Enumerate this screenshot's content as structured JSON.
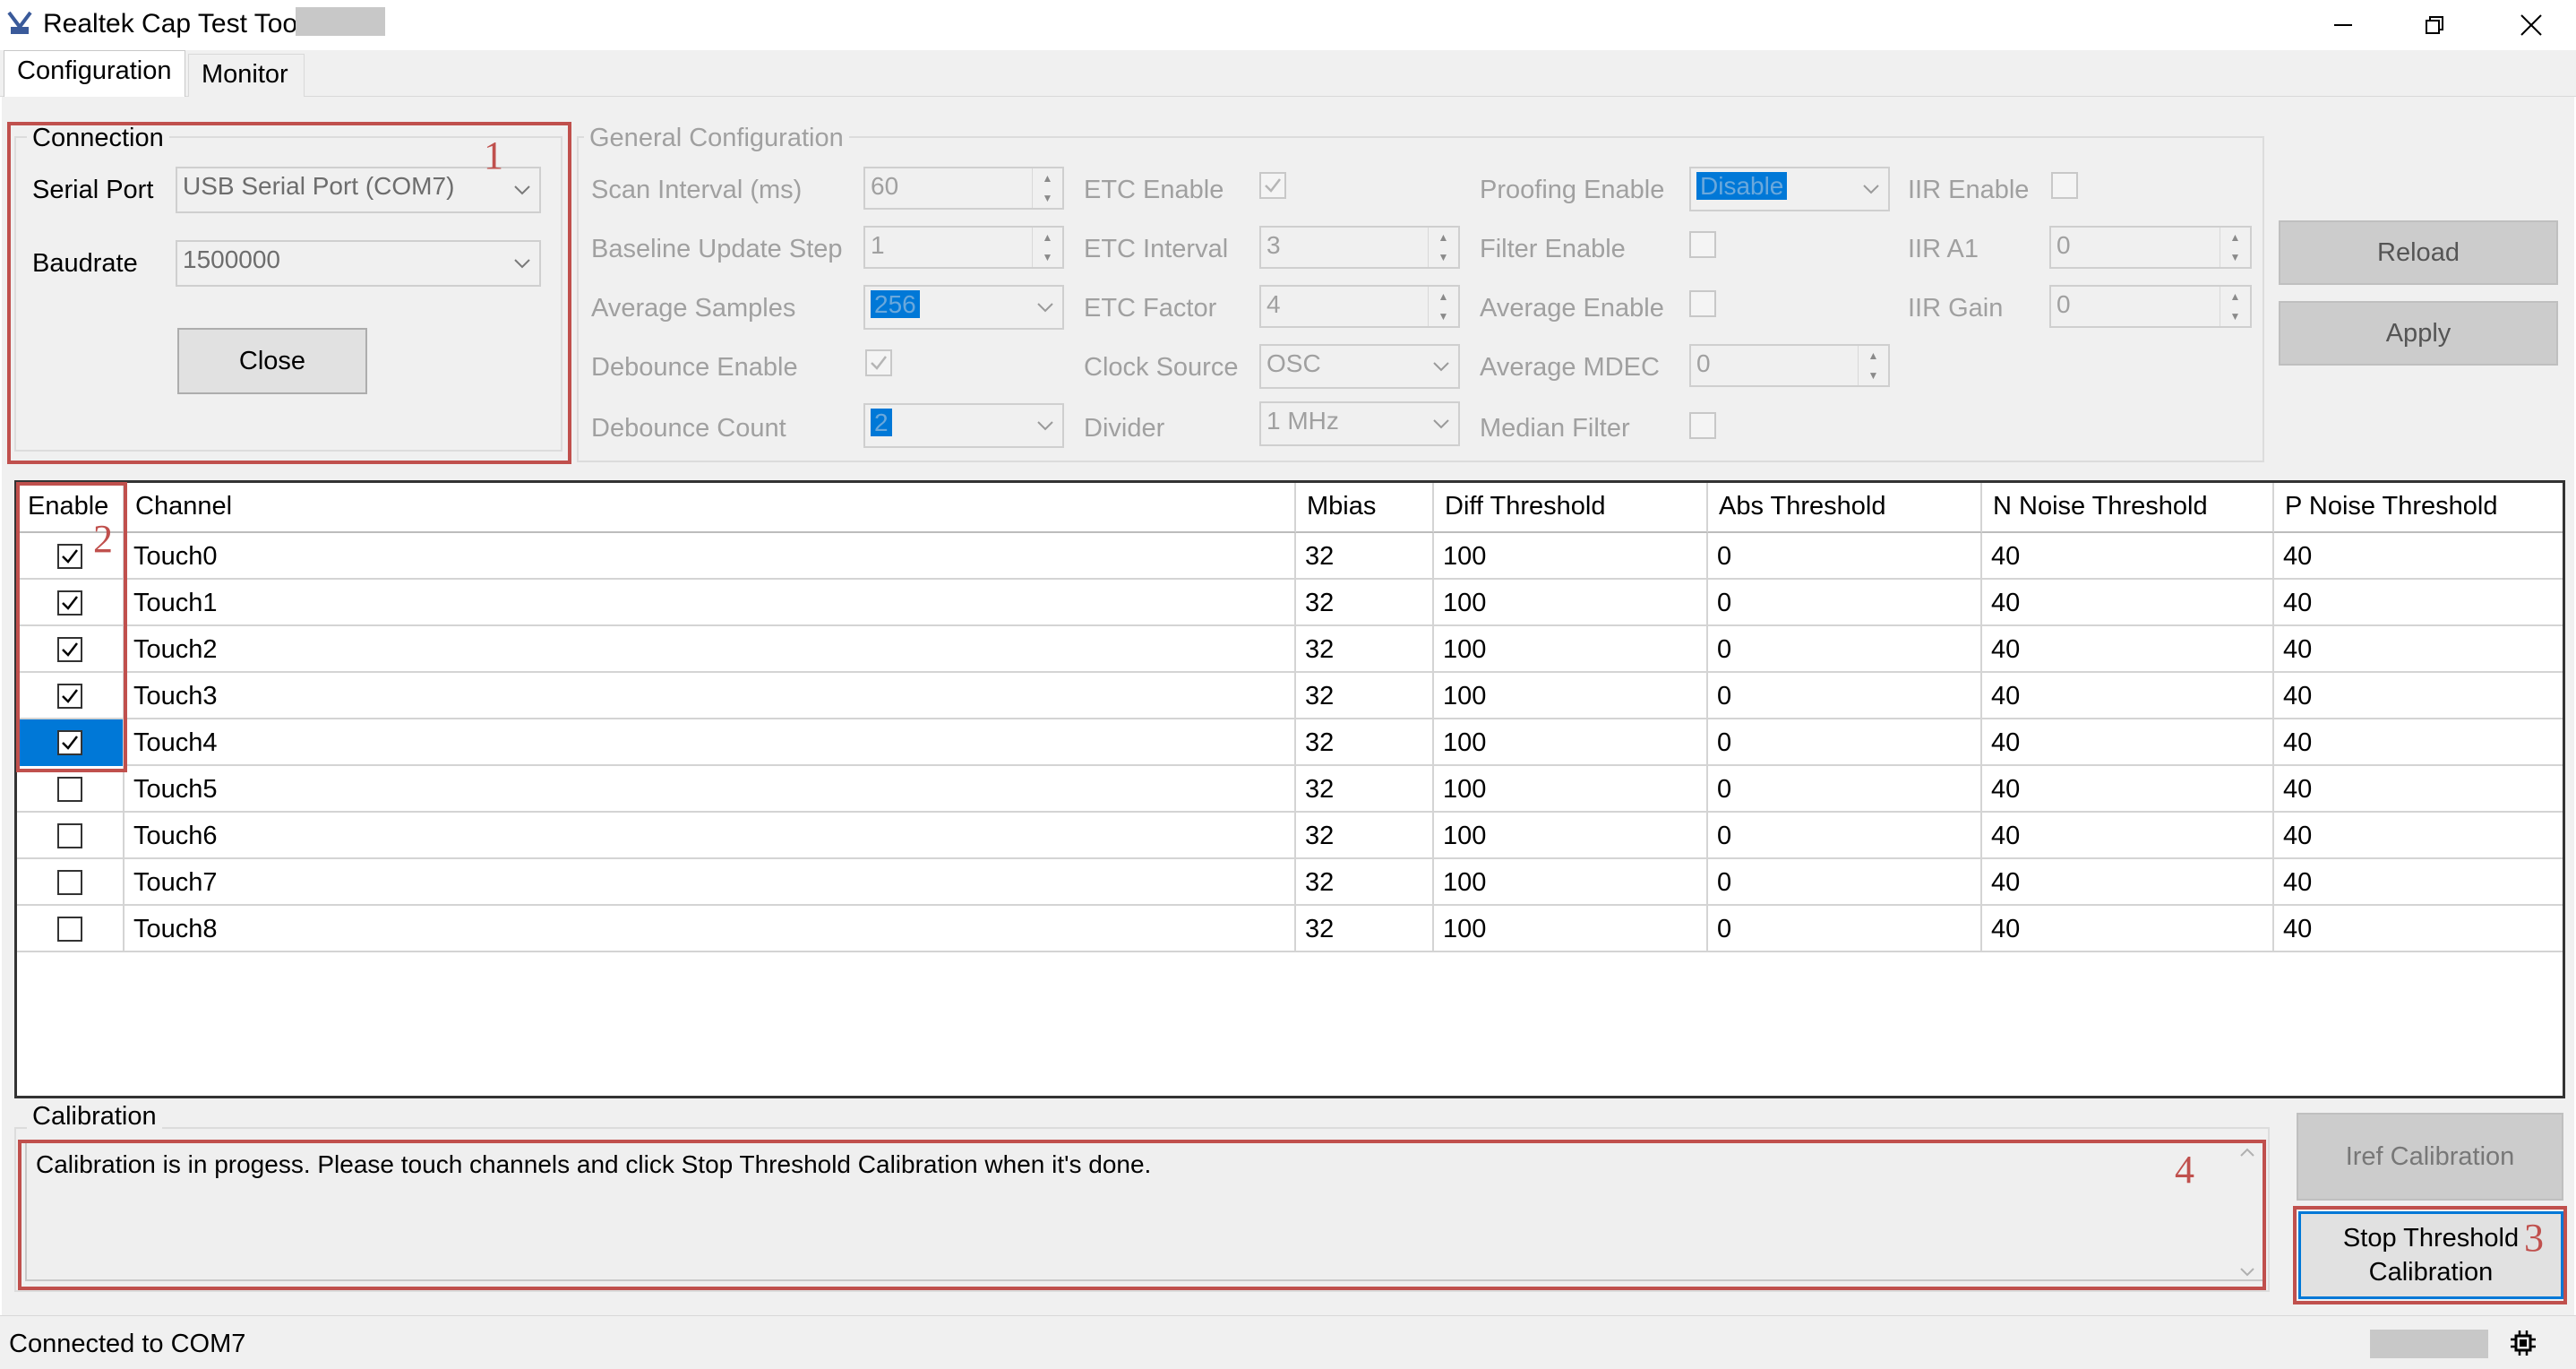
{
  "window": {
    "title": "Realtek Cap Test Tool",
    "controls": {
      "minimize": "minimize",
      "maximize": "restore",
      "close": "close"
    }
  },
  "tabs": [
    {
      "label": "Configuration",
      "selected": true
    },
    {
      "label": "Monitor",
      "selected": false
    }
  ],
  "connection": {
    "title": "Connection",
    "serial_port_label": "Serial Port",
    "serial_port_value": "USB Serial Port (COM7)",
    "baudrate_label": "Baudrate",
    "baudrate_value": "1500000",
    "close_button": "Close"
  },
  "general": {
    "title": "General Configuration",
    "scan_interval_label": "Scan Interval (ms)",
    "scan_interval_value": "60",
    "baseline_update_step_label": "Baseline Update Step",
    "baseline_update_step_value": "1",
    "average_samples_label": "Average Samples",
    "average_samples_value": "256",
    "debounce_enable_label": "Debounce Enable",
    "debounce_enable_checked": true,
    "debounce_count_label": "Debounce Count",
    "debounce_count_value": "2",
    "etc_enable_label": "ETC Enable",
    "etc_enable_checked": true,
    "etc_interval_label": "ETC Interval",
    "etc_interval_value": "3",
    "etc_factor_label": "ETC Factor",
    "etc_factor_value": "4",
    "clock_source_label": "Clock Source",
    "clock_source_value": "OSC",
    "divider_label": "Divider",
    "divider_value": "1 MHz",
    "proofing_enable_label": "Proofing Enable",
    "proofing_enable_value": "Disable",
    "filter_enable_label": "Filter Enable",
    "filter_enable_checked": false,
    "average_enable_label": "Average Enable",
    "average_enable_checked": false,
    "average_mdec_label": "Average MDEC",
    "average_mdec_value": "0",
    "median_filter_label": "Median Filter",
    "median_filter_checked": false,
    "iir_enable_label": "IIR Enable",
    "iir_enable_checked": false,
    "iir_a1_label": "IIR A1",
    "iir_a1_value": "0",
    "iir_gain_label": "IIR Gain",
    "iir_gain_value": "0"
  },
  "actions": {
    "reload": "Reload",
    "apply": "Apply"
  },
  "table": {
    "headers": [
      "Enable",
      "Channel",
      "Mbias",
      "Diff Threshold",
      "Abs Threshold",
      "N Noise Threshold",
      "P Noise Threshold"
    ],
    "rows": [
      {
        "enabled": true,
        "channel": "Touch0",
        "mbias": "32",
        "diff": "100",
        "abs": "0",
        "n_noise": "40",
        "p_noise": "40"
      },
      {
        "enabled": true,
        "channel": "Touch1",
        "mbias": "32",
        "diff": "100",
        "abs": "0",
        "n_noise": "40",
        "p_noise": "40"
      },
      {
        "enabled": true,
        "channel": "Touch2",
        "mbias": "32",
        "diff": "100",
        "abs": "0",
        "n_noise": "40",
        "p_noise": "40"
      },
      {
        "enabled": true,
        "channel": "Touch3",
        "mbias": "32",
        "diff": "100",
        "abs": "0",
        "n_noise": "40",
        "p_noise": "40"
      },
      {
        "enabled": true,
        "channel": "Touch4",
        "mbias": "32",
        "diff": "100",
        "abs": "0",
        "n_noise": "40",
        "p_noise": "40",
        "selected": true
      },
      {
        "enabled": false,
        "channel": "Touch5",
        "mbias": "32",
        "diff": "100",
        "abs": "0",
        "n_noise": "40",
        "p_noise": "40"
      },
      {
        "enabled": false,
        "channel": "Touch6",
        "mbias": "32",
        "diff": "100",
        "abs": "0",
        "n_noise": "40",
        "p_noise": "40"
      },
      {
        "enabled": false,
        "channel": "Touch7",
        "mbias": "32",
        "diff": "100",
        "abs": "0",
        "n_noise": "40",
        "p_noise": "40"
      },
      {
        "enabled": false,
        "channel": "Touch8",
        "mbias": "32",
        "diff": "100",
        "abs": "0",
        "n_noise": "40",
        "p_noise": "40"
      }
    ]
  },
  "calibration": {
    "title": "Calibration",
    "message": "Calibration is in progess. Please touch channels and click Stop Threshold Calibration when it's done.",
    "iref_button": "Iref Calibration",
    "stop_button": "Stop Threshold Calibration"
  },
  "status": {
    "text": "Connected to COM7"
  },
  "annotations": {
    "m1": "1",
    "m2": "2",
    "m3": "3",
    "m4": "4"
  },
  "colors": {
    "accent": "#0078d7",
    "annotation": "#c0504d"
  }
}
